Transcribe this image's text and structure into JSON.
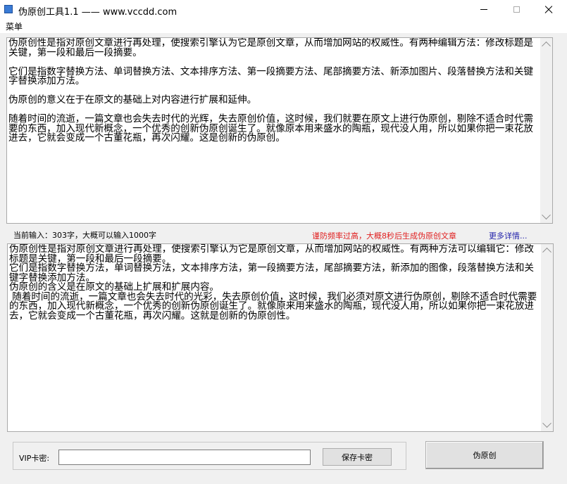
{
  "window": {
    "title": "伪原创工具1.1 —— www.vccdd.com"
  },
  "menu": {
    "items": [
      "菜单"
    ]
  },
  "input_box": {
    "text": "伪原创性是指对原创文章进行再处理，使搜索引擎认为它是原创文章，从而增加网站的权威性。有两种编辑方法：修改标题是关键，第一段和最后一段摘要。\n\n它们是指数字替换方法、单词替换方法、文本排序方法、第一段摘要方法、尾部摘要方法、新添加图片、段落替换方法和关键字替换添加方法。\n\n伪原创的意义在于在原文的基础上对内容进行扩展和延伸。\n\n随着时间的流逝，一篇文章也会失去时代的光辉，失去原创价值，这时候，我们就要在原文上进行伪原创，剔除不适合时代需要的东西，加入现代新概念，一个优秀的创新伪原创诞生了。就像原本用来盛水的陶瓶，现代没人用，所以如果你把一束花放进去，它就会变成一个古董花瓶，再次闪耀。这是创新的伪原创。"
  },
  "status": {
    "input_count": "当前输入：303字，大概可以输入1000字",
    "warning": "谨防频率过高，大概8秒后生成伪原创文章",
    "more_link": "更多详情..."
  },
  "output_box": {
    "text": "伪原创性是指对原创文章进行再处理，使搜索引擎认为它是原创文章，从而增加网站的权威性。有两种方法可以编辑它：修改标题是关键，第一段和最后一段摘要。\n它们是指数字替换方法，单词替换方法，文本排序方法，第一段摘要方法，尾部摘要方法，新添加的图像，段落替换方法和关键字替换添加方法。\n伪原创的含义是在原文的基础上扩展和扩展内容。\n 随着时间的流逝，一篇文章也会失去时代的光彩，失去原创价值，这时候，我们必须对原文进行伪原创，剔除不适合时代需要的东西，加入现代新概念，一个优秀的创新伪原创诞生了。就像原来用来盛水的陶瓶，现代没人用，所以如果你把一束花放进去，它就会变成一个古董花瓶，再次闪耀。这就是创新的伪原创性。"
  },
  "vip": {
    "label": "VIP卡密:",
    "value": "",
    "save_label": "保存卡密"
  },
  "action": {
    "generate_label": "伪原创"
  }
}
